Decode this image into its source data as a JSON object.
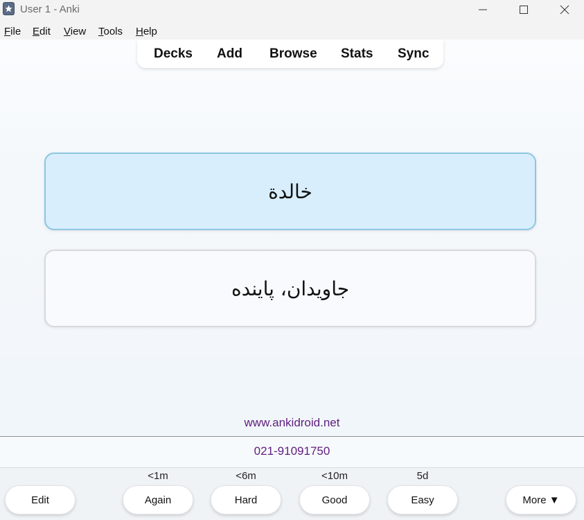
{
  "window": {
    "title": "User 1 - Anki",
    "controls": [
      "minimize-icon",
      "maximize-icon",
      "close-icon"
    ]
  },
  "menu": [
    {
      "key": "F",
      "rest": "ile"
    },
    {
      "key": "E",
      "rest": "dit"
    },
    {
      "key": "V",
      "rest": "iew"
    },
    {
      "key": "T",
      "rest": "ools"
    },
    {
      "key": "H",
      "rest": "elp"
    }
  ],
  "nav": {
    "decks": "Decks",
    "add": "Add",
    "browse": "Browse",
    "stats": "Stats",
    "sync": "Sync"
  },
  "card": {
    "front": "خالدة",
    "back": "جاویدان، پاینده"
  },
  "footer": {
    "website": "www.ankidroid.net",
    "phone": "021-91091750"
  },
  "answer_bar": {
    "edit": "Edit",
    "again": {
      "label": "Again",
      "interval": "<1m"
    },
    "hard": {
      "label": "Hard",
      "interval": "<6m"
    },
    "good": {
      "label": "Good",
      "interval": "<10m"
    },
    "easy": {
      "label": "Easy",
      "interval": "5d"
    },
    "more": "More ▼"
  },
  "colors": {
    "link": "#60207f",
    "front_card_bg": "#d8eefc",
    "front_card_border": "#8ec6e2"
  }
}
